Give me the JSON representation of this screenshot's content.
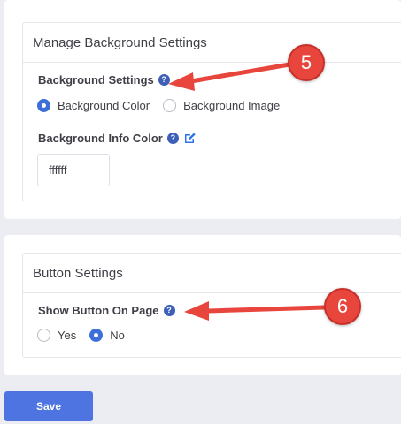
{
  "background_section": {
    "title": "Manage Background Settings",
    "settings_label": "Background Settings",
    "options": [
      {
        "label": "Background Color",
        "checked": true
      },
      {
        "label": "Background Image",
        "checked": false
      }
    ],
    "info_color_label": "Background Info Color",
    "info_color_value": "ffffff"
  },
  "button_section": {
    "title": "Button Settings",
    "show_button_label": "Show Button On Page",
    "options": [
      {
        "label": "Yes",
        "checked": false
      },
      {
        "label": "No",
        "checked": true
      }
    ]
  },
  "save_label": "Save",
  "annotations": {
    "marker_5": "5",
    "marker_6": "6"
  },
  "icons": {
    "help": "question-circle-icon",
    "edit": "edit-icon"
  },
  "colors": {
    "accent": "#3d6fd8",
    "save_button": "#4d74e0",
    "annotation": "#e8463c"
  }
}
